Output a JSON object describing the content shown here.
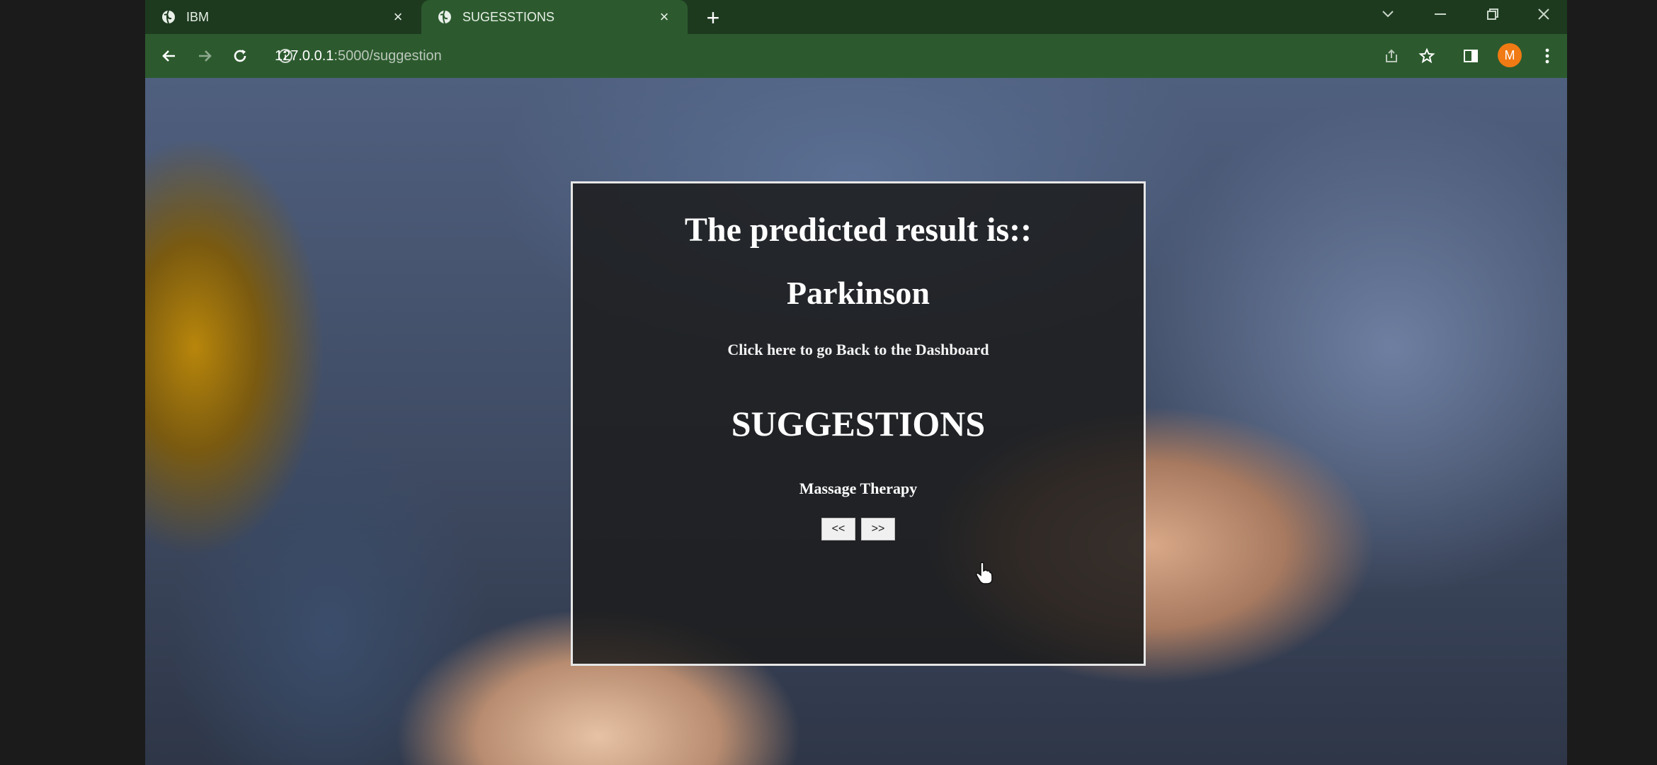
{
  "browser": {
    "tabs": [
      {
        "title": "IBM",
        "active": false
      },
      {
        "title": "SUGESSTIONS",
        "active": true
      }
    ],
    "url": {
      "host": "127.0.0.1",
      "path": ":5000/suggestion"
    },
    "profile_initial": "M",
    "colors": {
      "frame": "#1d3a1f",
      "toolbar": "#2c5a2e",
      "avatar": "#f07a13"
    }
  },
  "page": {
    "prediction_heading": "The predicted result is::",
    "prediction_result": "Parkinson",
    "back_link": "Click here to go Back to the Dashboard",
    "suggestions_heading": "SUGGESTIONS",
    "suggestion_item": "Massage Therapy",
    "prev_button": "<<",
    "next_button": ">>"
  }
}
